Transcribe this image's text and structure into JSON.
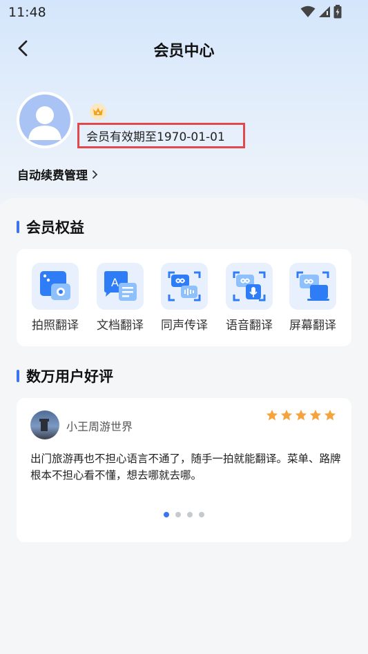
{
  "status_bar": {
    "time": "11:48"
  },
  "header": {
    "title": "会员中心"
  },
  "profile": {
    "expire_text": "会员有效期至1970-01-01",
    "renew_label": "自动续费管理"
  },
  "benefits": {
    "title": "会员权益",
    "items": [
      {
        "label": "拍照翻译",
        "icon": "photo-translate-icon"
      },
      {
        "label": "文档翻译",
        "icon": "document-translate-icon"
      },
      {
        "label": "同声传译",
        "icon": "simultaneous-interpret-icon"
      },
      {
        "label": "语音翻译",
        "icon": "voice-translate-icon"
      },
      {
        "label": "屏幕翻译",
        "icon": "screen-translate-icon"
      }
    ]
  },
  "reviews": {
    "title": "数万用户好评",
    "items": [
      {
        "user": "小王周游世界",
        "rating": 5,
        "text": "出门旅游再也不担心语言不通了，随手一拍就能翻译。菜单、路牌根本不担心看不懂，想去哪就去哪。"
      }
    ],
    "page_count": 4,
    "active_page": 1
  },
  "colors": {
    "accent": "#3b73f0",
    "highlight_border": "#e2474a",
    "star": "#f7a33c"
  }
}
